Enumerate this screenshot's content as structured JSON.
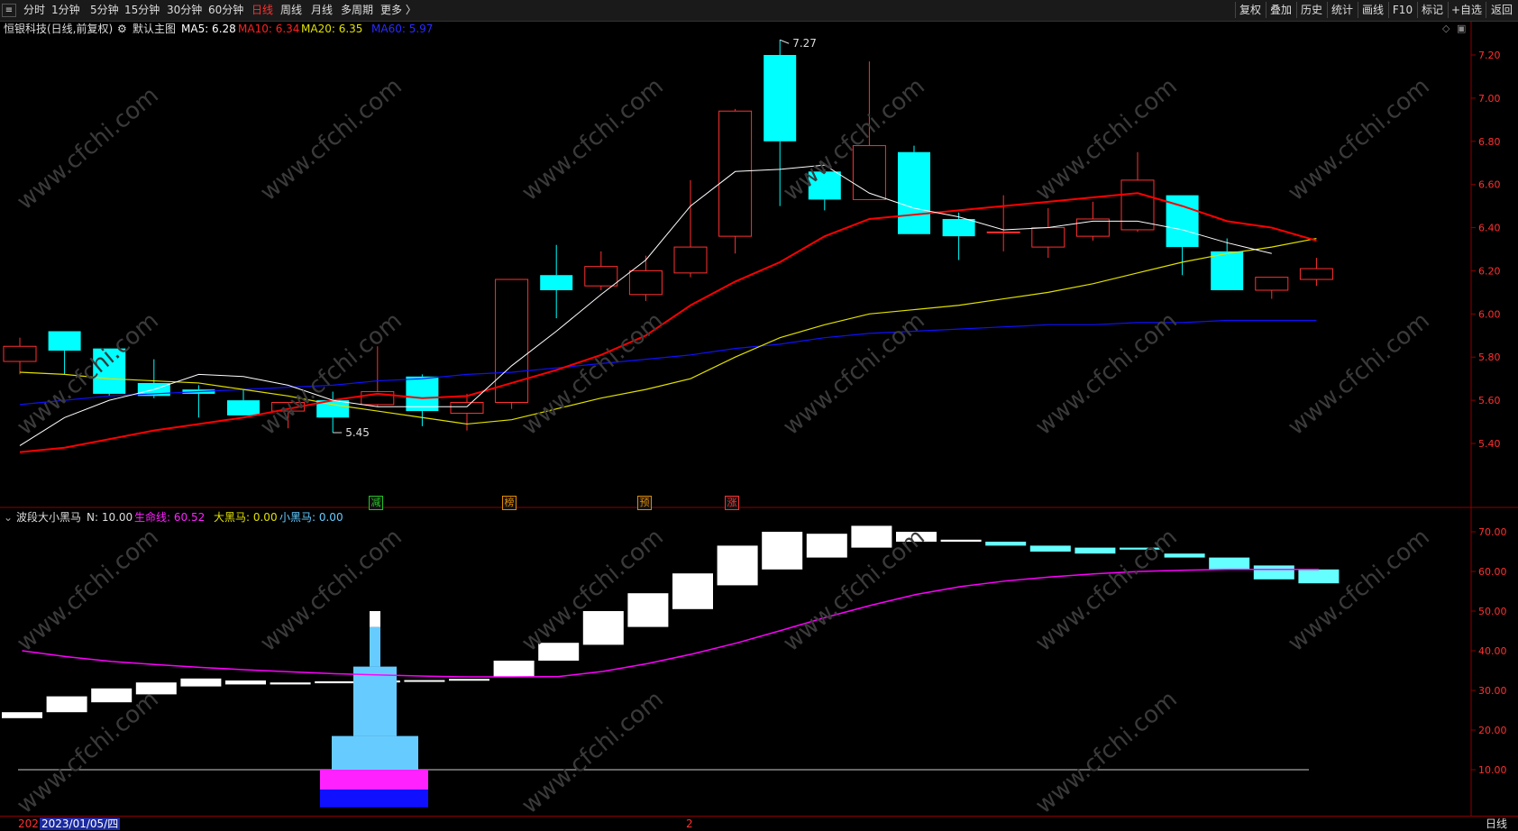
{
  "toolbar": {
    "menu_icon": "≡",
    "periods": [
      "分时",
      "1分钟",
      "5分钟",
      "15分钟",
      "30分钟",
      "60分钟",
      "日线",
      "周线",
      "月线",
      "多周期",
      "更多 〉"
    ],
    "active_period": "日线",
    "right_buttons": [
      "复权",
      "叠加",
      "历史",
      "统计",
      "画线",
      "F10",
      "标记",
      "+自选",
      "返回"
    ]
  },
  "main_chart": {
    "stock_title": "恒银科技(日线,前复权)",
    "indicator_name": "默认主图",
    "ma5": "MA5: 6.28",
    "ma10": "MA10: 6.34",
    "ma20": "MA20: 6.35",
    "ma60": "MA60: 5.97",
    "high_label": "7.27",
    "low_label": "5.45",
    "y_ticks": [
      "7.20",
      "7.00",
      "6.80",
      "6.60",
      "6.40",
      "6.20",
      "6.00",
      "5.80",
      "5.60",
      "5.40"
    ],
    "signals": [
      {
        "text": "减",
        "color": "#22c322"
      },
      {
        "text": "榜",
        "color": "#e08a00"
      },
      {
        "text": "预",
        "color": "#e08a00"
      },
      {
        "text": "涨",
        "color": "#ff3030"
      }
    ],
    "colors": {
      "up": "#ff3030",
      "down": "#00ffff",
      "ma5": "#ffffff",
      "ma10": "#ff0000",
      "ma20": "#e0e000",
      "ma60": "#1010ff"
    }
  },
  "indicator": {
    "name": "波段大小黑马",
    "n_param": "N: 10.00",
    "life_line": "生命线: 60.52",
    "big_horse": "大黑马: 0.00",
    "small_horse": "小黑马: 0.00",
    "y_ticks": [
      "70.00",
      "60.00",
      "50.00",
      "40.00",
      "30.00",
      "20.00",
      "10.00"
    ],
    "colors": {
      "life": "#ff00ff",
      "big": "#ffff00",
      "small": "#66ccff"
    }
  },
  "bottom": {
    "year_prefix": "202",
    "date": "2023/01/05/四",
    "mid_mark": "2",
    "period_label": "日线"
  },
  "watermark": "www.cfchi.com",
  "chart_data": [
    {
      "type": "candlestick",
      "title": "恒银科技(日线,前复权)",
      "ylim": [
        5.3,
        7.3
      ],
      "candles": [
        {
          "o": 5.78,
          "h": 5.89,
          "l": 5.72,
          "c": 5.85
        },
        {
          "o": 5.92,
          "h": 5.92,
          "l": 5.72,
          "c": 5.83
        },
        {
          "o": 5.84,
          "h": 5.84,
          "l": 5.62,
          "c": 5.63
        },
        {
          "o": 5.68,
          "h": 5.79,
          "l": 5.61,
          "c": 5.62
        },
        {
          "o": 5.65,
          "h": 5.67,
          "l": 5.52,
          "c": 5.63
        },
        {
          "o": 5.6,
          "h": 5.65,
          "l": 5.54,
          "c": 5.53
        },
        {
          "o": 5.55,
          "h": 5.59,
          "l": 5.47,
          "c": 5.59
        },
        {
          "o": 5.6,
          "h": 5.64,
          "l": 5.45,
          "c": 5.52
        },
        {
          "o": 5.58,
          "h": 5.85,
          "l": 5.57,
          "c": 5.64
        },
        {
          "o": 5.71,
          "h": 5.72,
          "l": 5.48,
          "c": 5.55
        },
        {
          "o": 5.54,
          "h": 5.63,
          "l": 5.46,
          "c": 5.59
        },
        {
          "o": 5.59,
          "h": 6.16,
          "l": 5.56,
          "c": 6.16
        },
        {
          "o": 6.18,
          "h": 6.32,
          "l": 5.98,
          "c": 6.11
        },
        {
          "o": 6.13,
          "h": 6.29,
          "l": 6.11,
          "c": 6.22
        },
        {
          "o": 6.09,
          "h": 6.27,
          "l": 6.06,
          "c": 6.2
        },
        {
          "o": 6.19,
          "h": 6.62,
          "l": 6.17,
          "c": 6.31
        },
        {
          "o": 6.36,
          "h": 6.95,
          "l": 6.28,
          "c": 6.94
        },
        {
          "o": 7.2,
          "h": 7.27,
          "l": 6.5,
          "c": 6.8
        },
        {
          "o": 6.66,
          "h": 6.67,
          "l": 6.48,
          "c": 6.53
        },
        {
          "o": 6.53,
          "h": 7.17,
          "l": 6.53,
          "c": 6.78
        },
        {
          "o": 6.75,
          "h": 6.78,
          "l": 6.37,
          "c": 6.37
        },
        {
          "o": 6.44,
          "h": 6.47,
          "l": 6.25,
          "c": 6.36
        },
        {
          "o": 6.38,
          "h": 6.55,
          "l": 6.29,
          "c": 6.38
        },
        {
          "o": 6.31,
          "h": 6.49,
          "l": 6.26,
          "c": 6.4
        },
        {
          "o": 6.36,
          "h": 6.52,
          "l": 6.34,
          "c": 6.44
        },
        {
          "o": 6.39,
          "h": 6.75,
          "l": 6.38,
          "c": 6.62
        },
        {
          "o": 6.55,
          "h": 6.55,
          "l": 6.18,
          "c": 6.31
        },
        {
          "o": 6.29,
          "h": 6.35,
          "l": 6.11,
          "c": 6.11
        },
        {
          "o": 6.11,
          "h": 6.17,
          "l": 6.07,
          "c": 6.17
        },
        {
          "o": 6.16,
          "h": 6.26,
          "l": 6.13,
          "c": 6.21
        }
      ],
      "ma5": [
        5.39,
        5.52,
        5.6,
        5.65,
        5.72,
        5.71,
        5.67,
        5.6,
        5.57,
        5.57,
        5.57,
        5.76,
        5.92,
        6.09,
        6.25,
        6.5,
        6.66,
        6.67,
        6.69,
        6.56,
        6.49,
        6.45,
        6.39,
        6.4,
        6.43,
        6.43,
        6.39,
        6.33,
        6.28
      ],
      "ma10": [
        5.36,
        5.38,
        5.42,
        5.46,
        5.49,
        5.52,
        5.56,
        5.6,
        5.63,
        5.61,
        5.62,
        5.68,
        5.74,
        5.81,
        5.9,
        6.04,
        6.15,
        6.24,
        6.36,
        6.44,
        6.46,
        6.48,
        6.5,
        6.52,
        6.54,
        6.56,
        6.5,
        6.43,
        6.4,
        6.34
      ],
      "ma20": [
        5.73,
        5.72,
        5.7,
        5.69,
        5.68,
        5.65,
        5.62,
        5.58,
        5.55,
        5.52,
        5.49,
        5.51,
        5.56,
        5.61,
        5.65,
        5.7,
        5.8,
        5.89,
        5.95,
        6.0,
        6.02,
        6.04,
        6.07,
        6.1,
        6.14,
        6.19,
        6.24,
        6.28,
        6.31,
        6.35
      ],
      "ma60": [
        5.58,
        5.6,
        5.62,
        5.63,
        5.64,
        5.65,
        5.66,
        5.67,
        5.69,
        5.7,
        5.72,
        5.73,
        5.75,
        5.77,
        5.79,
        5.81,
        5.84,
        5.86,
        5.89,
        5.91,
        5.92,
        5.93,
        5.94,
        5.95,
        5.95,
        5.96,
        5.96,
        5.97,
        5.97,
        5.97
      ]
    },
    {
      "type": "bar",
      "title": "波段大小黑马",
      "ylim": [
        0,
        75
      ],
      "step_blocks": [
        [
          23,
          24.5
        ],
        [
          24.5,
          28.5
        ],
        [
          27,
          30.5
        ],
        [
          29,
          32
        ],
        [
          31,
          33
        ],
        [
          31.5,
          32.5
        ],
        [
          31.5,
          32
        ],
        [
          31.8,
          32.3
        ],
        [
          32,
          32.5
        ],
        [
          32.3,
          32.6
        ],
        [
          32.6,
          32.9
        ],
        [
          33.5,
          37.5
        ],
        [
          37.5,
          42
        ],
        [
          41.5,
          50
        ],
        [
          46,
          54.5
        ],
        [
          50.5,
          59.5
        ],
        [
          56.5,
          66.5
        ],
        [
          60.5,
          70
        ],
        [
          63.5,
          69.5
        ],
        [
          66,
          71.5
        ],
        [
          67.5,
          70
        ],
        [
          67.5,
          68
        ],
        [
          66.5,
          67.5
        ],
        [
          65,
          66.5
        ],
        [
          64.5,
          66
        ],
        [
          65.5,
          66
        ],
        [
          63.5,
          64.5
        ],
        [
          60.5,
          63.5
        ],
        [
          58,
          61.5
        ],
        [
          57,
          60.5
        ]
      ],
      "step_colors": [
        "#ffffff",
        "#ffffff",
        "#ffffff",
        "#ffffff",
        "#ffffff",
        "#ffffff",
        "#ffffff",
        "#ffffff",
        "#ffffff",
        "#ffffff",
        "#ffffff",
        "#ffffff",
        "#ffffff",
        "#ffffff",
        "#ffffff",
        "#ffffff",
        "#ffffff",
        "#ffffff",
        "#ffffff",
        "#ffffff",
        "#ffffff",
        "#ffffff",
        "#66ffff",
        "#66ffff",
        "#66ffff",
        "#66ffff",
        "#66ffff",
        "#66ffff",
        "#66ffff",
        "#66ffff"
      ],
      "life_line": [
        40,
        38.5,
        37.3,
        36.5,
        35.8,
        35.2,
        34.7,
        34.2,
        33.9,
        33.6,
        33.4,
        33.4,
        33.5,
        34.8,
        36.8,
        39.2,
        42,
        45.2,
        48.5,
        51.5,
        54.2,
        56.2,
        57.6,
        58.6,
        59.4,
        60,
        60.3,
        60.5,
        60.5,
        60.52
      ],
      "base_line": 10,
      "tower": [
        {
          "from": 0,
          "to": 10,
          "color": "#ff22ff"
        },
        {
          "from": 5,
          "to": 0,
          "color": "#1010ff"
        },
        {
          "from": 10,
          "to": 19,
          "color": "#66ccff"
        },
        {
          "from": 19,
          "to": 36,
          "color": "#66ccff"
        },
        {
          "from": 36,
          "to": 46,
          "color": "#66ccff"
        },
        {
          "from": 46,
          "to": 50,
          "color": "#ffffff"
        }
      ]
    }
  ]
}
